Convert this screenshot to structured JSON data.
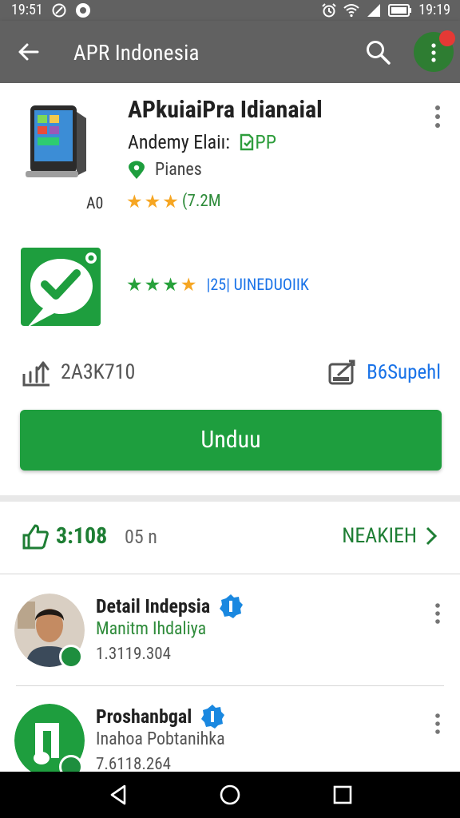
{
  "status_bar": {
    "time_left": "19:51",
    "time_right": "19:19"
  },
  "app_bar": {
    "title": "APR Indonesia"
  },
  "app": {
    "name": "APkuiaiPra Idianaial",
    "developer": "Andemy Elaiı:",
    "developer_tag": "PP",
    "category": "Pianes",
    "age": "A0",
    "rating_text": "(7.2M",
    "rating2_text": "|25| UINEDUOIIK"
  },
  "stats": {
    "downloads": "2A3K710",
    "size": "B6Supehl"
  },
  "install_button": {
    "label": "Unduu"
  },
  "reviews": {
    "count": "3:108",
    "sub": "05 n",
    "more": "NEAKIEH"
  },
  "list": [
    {
      "title": "Detail Indepsia",
      "subtitle": "Manitm Ihdaliya",
      "number": "1.3119.304"
    },
    {
      "title": "Proshanbgal",
      "subtitle": "Inahoa Pobtanihka",
      "number": "7.6118.264"
    }
  ],
  "colors": {
    "accent_green": "#1e9e3e",
    "app_bar": "#616161",
    "link_blue": "#1a73e8",
    "star_orange": "#f6a623"
  }
}
